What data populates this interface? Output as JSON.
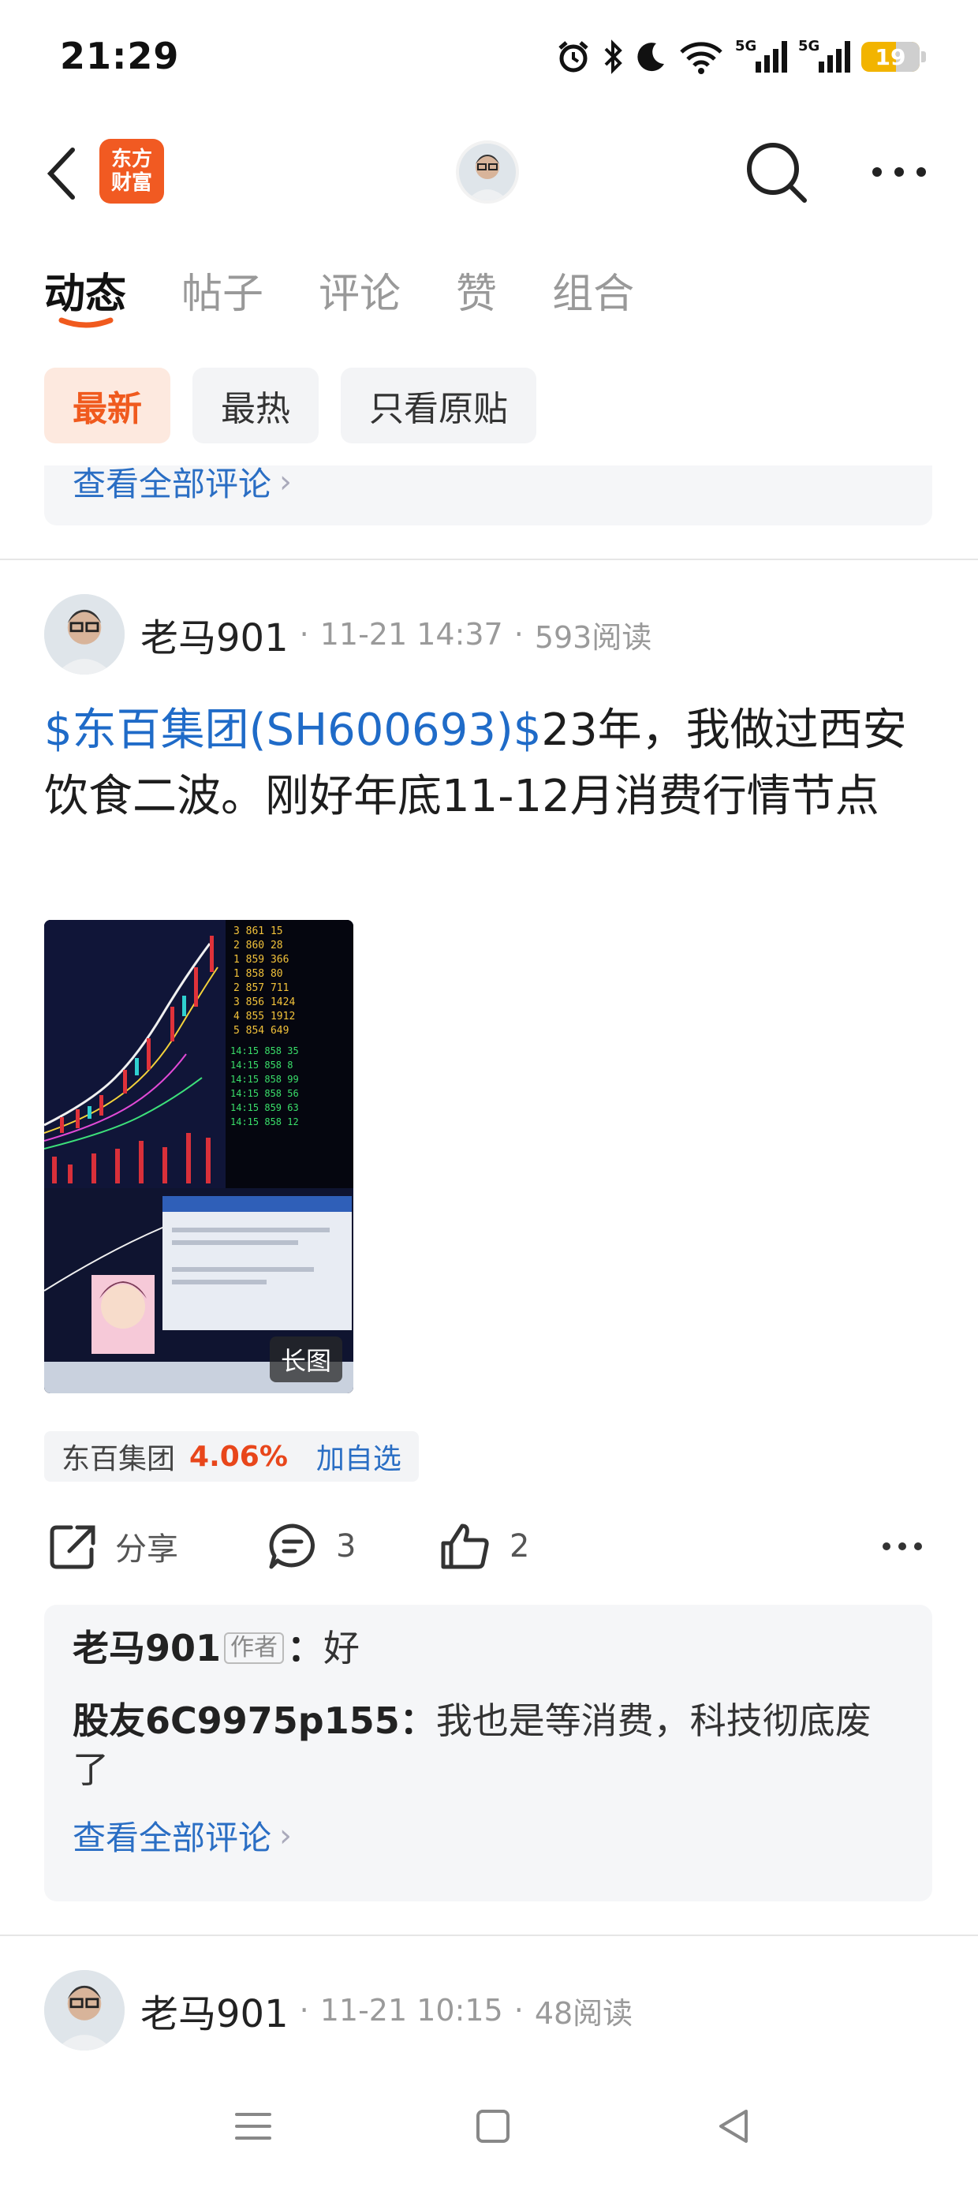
{
  "status_bar": {
    "time": "21:29",
    "network_1": "5G",
    "network_2": "5G",
    "battery": "19"
  },
  "nav": {
    "logo_line1": "东方",
    "logo_line2": "财富"
  },
  "tabs": [
    {
      "label": "动态",
      "active": true
    },
    {
      "label": "帖子",
      "active": false
    },
    {
      "label": "评论",
      "active": false
    },
    {
      "label": "赞",
      "active": false
    },
    {
      "label": "组合",
      "active": false
    }
  ],
  "filters": [
    {
      "label": "最新",
      "active": true
    },
    {
      "label": "最热",
      "active": false
    },
    {
      "label": "只看原贴",
      "active": false
    }
  ],
  "prev_card": {
    "view_all": "查看全部评论"
  },
  "post": {
    "author": "老马901",
    "date": "11-21 14:37",
    "reads": "593阅读",
    "stock_link": "$东百集团(SH600693)$",
    "text": "23年，我做过西安饮食二波。刚好年底11-12月消费行情节点",
    "image_badge": "长图",
    "stock_chip": {
      "name": "东百集团",
      "change": "4.06%",
      "add": "加自选"
    },
    "actions": {
      "share": "分享",
      "comments": "3",
      "likes": "2"
    },
    "comments": [
      {
        "user": "老马901",
        "tag": "作者",
        "sep": "：",
        "text": "好"
      },
      {
        "user": "股友6C9975p155",
        "sep": "：",
        "text": "我也是等消费，科技彻底废了"
      }
    ],
    "view_all": "查看全部评论"
  },
  "next_post": {
    "author": "老马901",
    "date": "11-21 10:15",
    "reads": "48阅读"
  },
  "colors": {
    "accent": "#f05a1e",
    "link": "#2a6ec4",
    "up": "#e8461b"
  }
}
